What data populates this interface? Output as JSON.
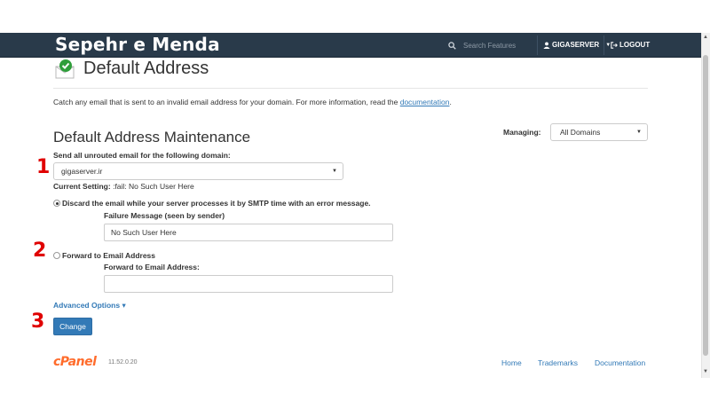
{
  "header": {
    "brand": "Sepehr e Menda",
    "search_placeholder": "Search Features",
    "user_label": "GIGASERVER",
    "logout_label": "LOGOUT"
  },
  "page": {
    "title": "Default Address",
    "description_text": "Catch any email that is sent to an invalid email address for your domain. For more information, read the ",
    "description_link": "documentation",
    "description_end": "."
  },
  "section": {
    "title": "Default Address Maintenance",
    "managing_label": "Managing:",
    "managing_value": "All Domains"
  },
  "form": {
    "domain_label": "Send all unrouted email for the following domain:",
    "domain_value": "gigaserver.ir",
    "current_setting_label": "Current Setting:",
    "current_setting_value": ":fail: No Such User Here",
    "discard_label": "Discard the email while your server processes it by SMTP time with an error message.",
    "failure_label": "Failure Message (seen by sender)",
    "failure_value": "No Such User Here",
    "forward_label": "Forward to Email Address",
    "forward_address_label": "Forward to Email Address:",
    "forward_value": "",
    "advanced_label": "Advanced Options ▾",
    "change_button": "Change",
    "selected_option": "discard"
  },
  "markers": [
    "1",
    "2",
    "3"
  ],
  "footer": {
    "logo": "cPanel",
    "version": "11.52.0.20",
    "links": [
      "Home",
      "Trademarks",
      "Documentation"
    ]
  },
  "colors": {
    "topbar": "#293a4a",
    "link": "#337ab7",
    "button": "#337ab7",
    "marker": "#e00000",
    "cpanel_orange": "#ff6c2c",
    "check_green": "#2e9e3a"
  },
  "icons": [
    "search-icon",
    "user-icon",
    "logout-icon",
    "envelope-check-icon"
  ]
}
